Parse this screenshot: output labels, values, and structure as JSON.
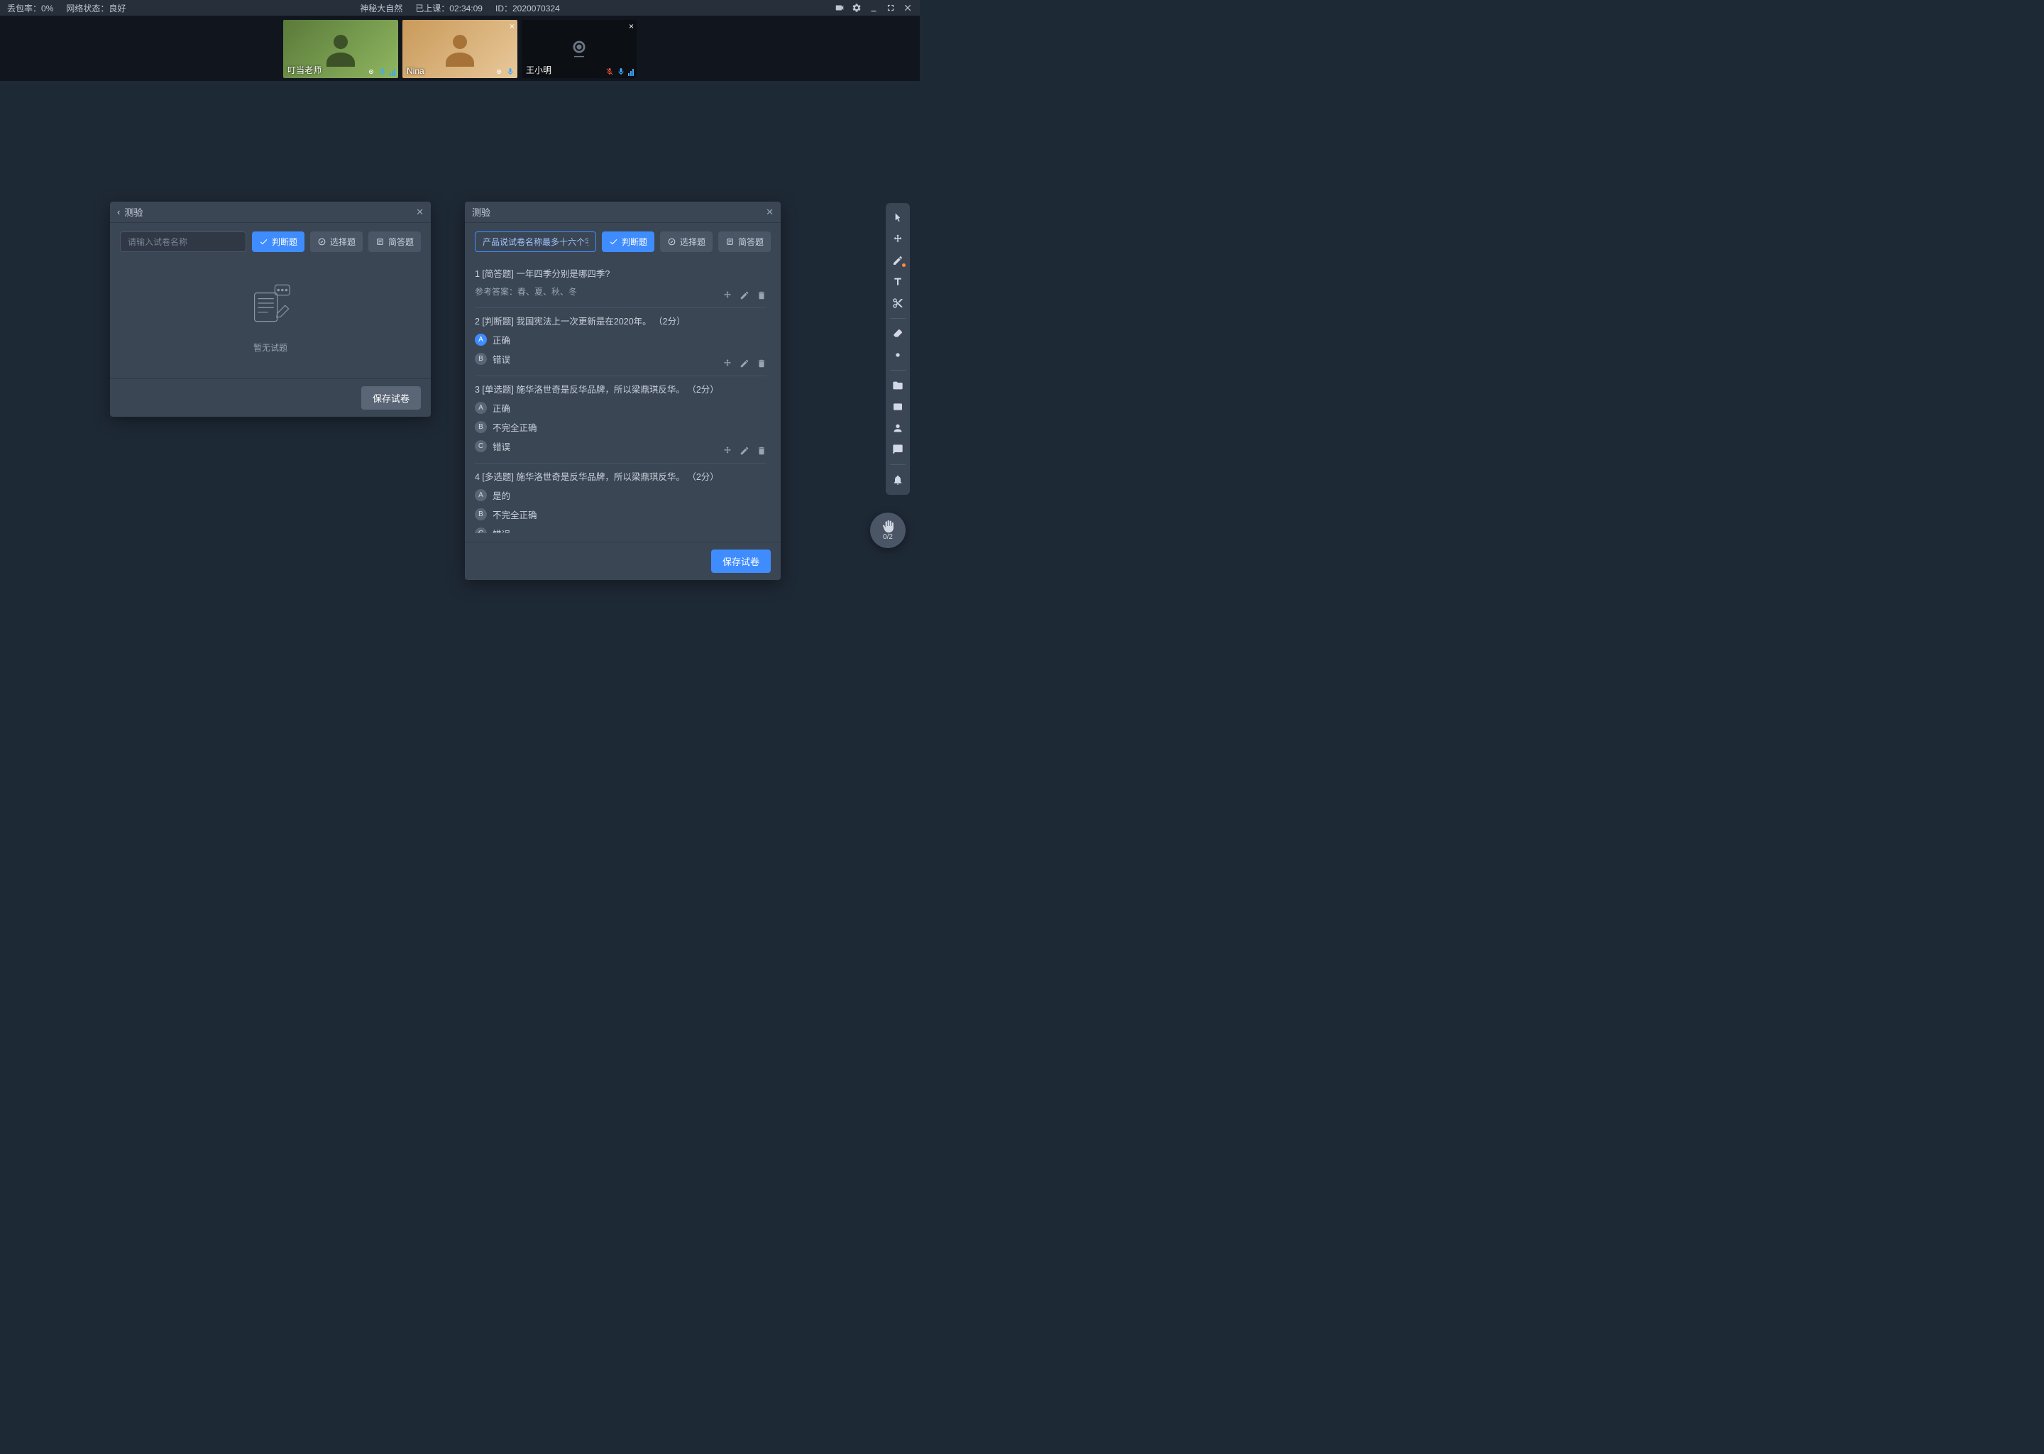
{
  "topbar": {
    "packet_loss_label": "丢包率：",
    "packet_loss_value": "0%",
    "network_label": "网络状态：",
    "network_value": "良好",
    "course_name": "神秘大自然",
    "duration_label": "已上课：",
    "duration_value": "02:34:09",
    "id_label": "ID：",
    "id_value": "2020070324"
  },
  "videos": [
    {
      "name": "叮当老师",
      "closable": false,
      "camera_off": false,
      "mic_muted": false,
      "theme": "green"
    },
    {
      "name": "Nina",
      "closable": true,
      "camera_off": false,
      "mic_muted": false,
      "theme": "tan"
    },
    {
      "name": "王小明",
      "closable": true,
      "camera_off": true,
      "mic_muted": true,
      "theme": "dark"
    }
  ],
  "panel1": {
    "title": "测验",
    "placeholder": "请输入试卷名称",
    "btn_true_false": "判断题",
    "btn_choice": "选择题",
    "btn_short": "简答题",
    "empty_text": "暂无试题",
    "save": "保存试卷"
  },
  "panel2": {
    "title": "测验",
    "name_value": "产品说试卷名称最多十六个字",
    "btn_true_false": "判断题",
    "btn_choice": "选择题",
    "btn_short": "简答题",
    "save": "保存试卷",
    "questions": [
      {
        "idx": "1",
        "type": "[简答题]",
        "text": "一年四季分别是哪四季?",
        "reference_label": "参考答案：",
        "reference": "春、夏、秋、冬",
        "options": []
      },
      {
        "idx": "2",
        "type": "[判断题]",
        "text": "我国宪法上一次更新是在2020年。",
        "points": "（2分）",
        "options": [
          {
            "letter": "A",
            "text": "正确",
            "selected": true
          },
          {
            "letter": "B",
            "text": "错误",
            "selected": false
          }
        ]
      },
      {
        "idx": "3",
        "type": "[单选题]",
        "text": "施华洛世奇是反华品牌，所以梁鼎琪反华。",
        "points": "（2分）",
        "options": [
          {
            "letter": "A",
            "text": "正确",
            "selected": false
          },
          {
            "letter": "B",
            "text": "不完全正确",
            "selected": false
          },
          {
            "letter": "C",
            "text": "错误",
            "selected": false
          }
        ]
      },
      {
        "idx": "4",
        "type": "[多选题]",
        "text": "施华洛世奇是反华品牌，所以梁鼎琪反华。",
        "points": "（2分）",
        "options": [
          {
            "letter": "A",
            "text": "是的",
            "selected": false
          },
          {
            "letter": "B",
            "text": "不完全正确",
            "selected": false
          },
          {
            "letter": "C",
            "text": "错误",
            "selected": false
          }
        ]
      }
    ]
  },
  "hand": {
    "count": "0/2"
  }
}
